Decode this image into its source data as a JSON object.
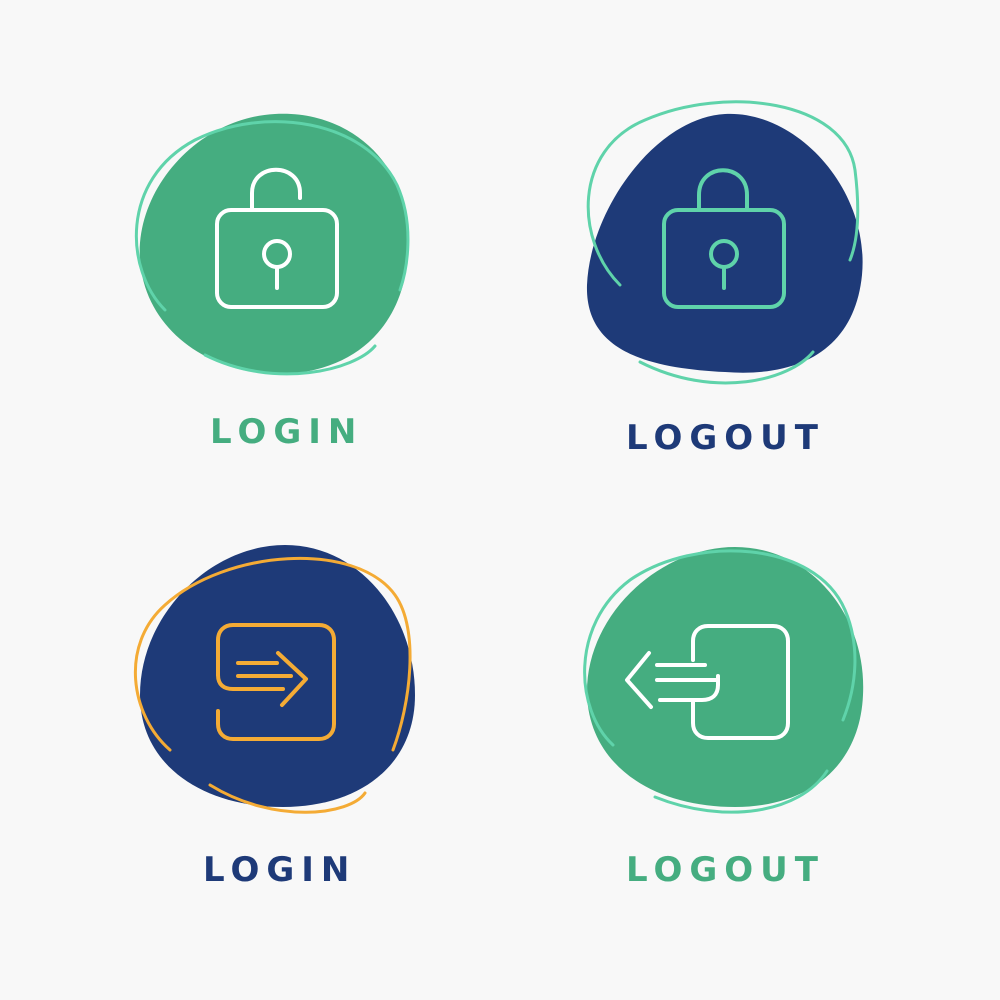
{
  "colors": {
    "background": "#f8f8f8",
    "green": "#45ad80",
    "navy": "#1e3a78",
    "mint": "#5fd3aa",
    "orange": "#f4ab35",
    "white": "#ffffff"
  },
  "tiles": [
    {
      "label": "LOGIN",
      "icon": "open-padlock-icon",
      "blob_color": "#45ad80",
      "ring_color": "#5fd3aa",
      "icon_color": "#ffffff",
      "label_color": "#45ad80"
    },
    {
      "label": "LOGOUT",
      "icon": "closed-padlock-icon",
      "blob_color": "#1e3a78",
      "ring_color": "#5fd3aa",
      "icon_color": "#5fd3aa",
      "label_color": "#1e3a78"
    },
    {
      "label": "LOGIN",
      "icon": "enter-arrow-icon",
      "blob_color": "#1e3a78",
      "ring_color": "#f4ab35",
      "icon_color": "#f4ab35",
      "label_color": "#1e3a78"
    },
    {
      "label": "LOGOUT",
      "icon": "exit-arrow-icon",
      "blob_color": "#45ad80",
      "ring_color": "#5fd3aa",
      "icon_color": "#ffffff",
      "label_color": "#45ad80"
    }
  ]
}
